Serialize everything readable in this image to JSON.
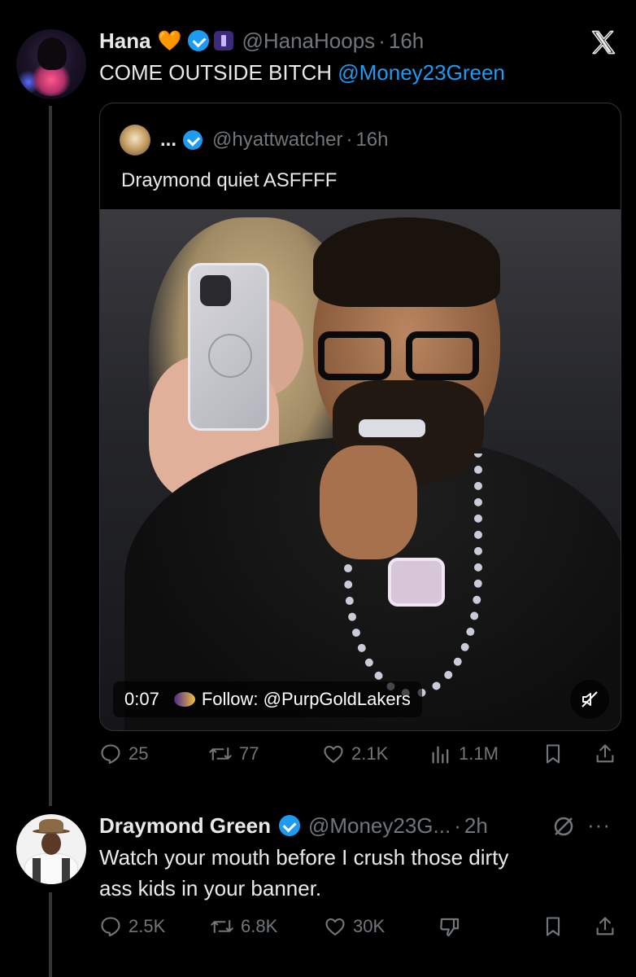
{
  "tweet1": {
    "name": "Hana",
    "handle": "@HanaHoops",
    "time": "16h",
    "text_plain": "COME OUTSIDE BITCH ",
    "text_mention": "@Money23Green",
    "heart_emoji": "🧡"
  },
  "quote": {
    "name": "...",
    "handle": "@hyattwatcher",
    "time": "16h",
    "text": "Draymond quiet ASFFFF",
    "video_time": "0:07",
    "video_overlay": "Follow: @PurpGoldLakers"
  },
  "tweet1_stats": {
    "replies": "25",
    "reposts": "77",
    "likes": "2.1K",
    "views": "1.1M"
  },
  "tweet2": {
    "name": "Draymond Green",
    "handle": "@Money23G...",
    "time": "2h",
    "text_line1": "Watch your mouth before I crush those dirty",
    "text_line2": "ass kids in your banner.",
    "more": "···",
    "replies": "2.5K",
    "reposts": "6.8K",
    "likes": "30K"
  },
  "colors": {
    "background": "#000000",
    "text": "#e7e9ea",
    "muted": "#71767b",
    "accent": "#1d9bf0",
    "verified": "#1d9bf0"
  },
  "icons": [
    "x-logo-icon",
    "verified-icon",
    "reply-icon",
    "repost-icon",
    "like-icon",
    "views-icon",
    "bookmark-icon",
    "share-icon",
    "mute-icon",
    "grok-icon",
    "more-icon",
    "dislike-icon"
  ]
}
